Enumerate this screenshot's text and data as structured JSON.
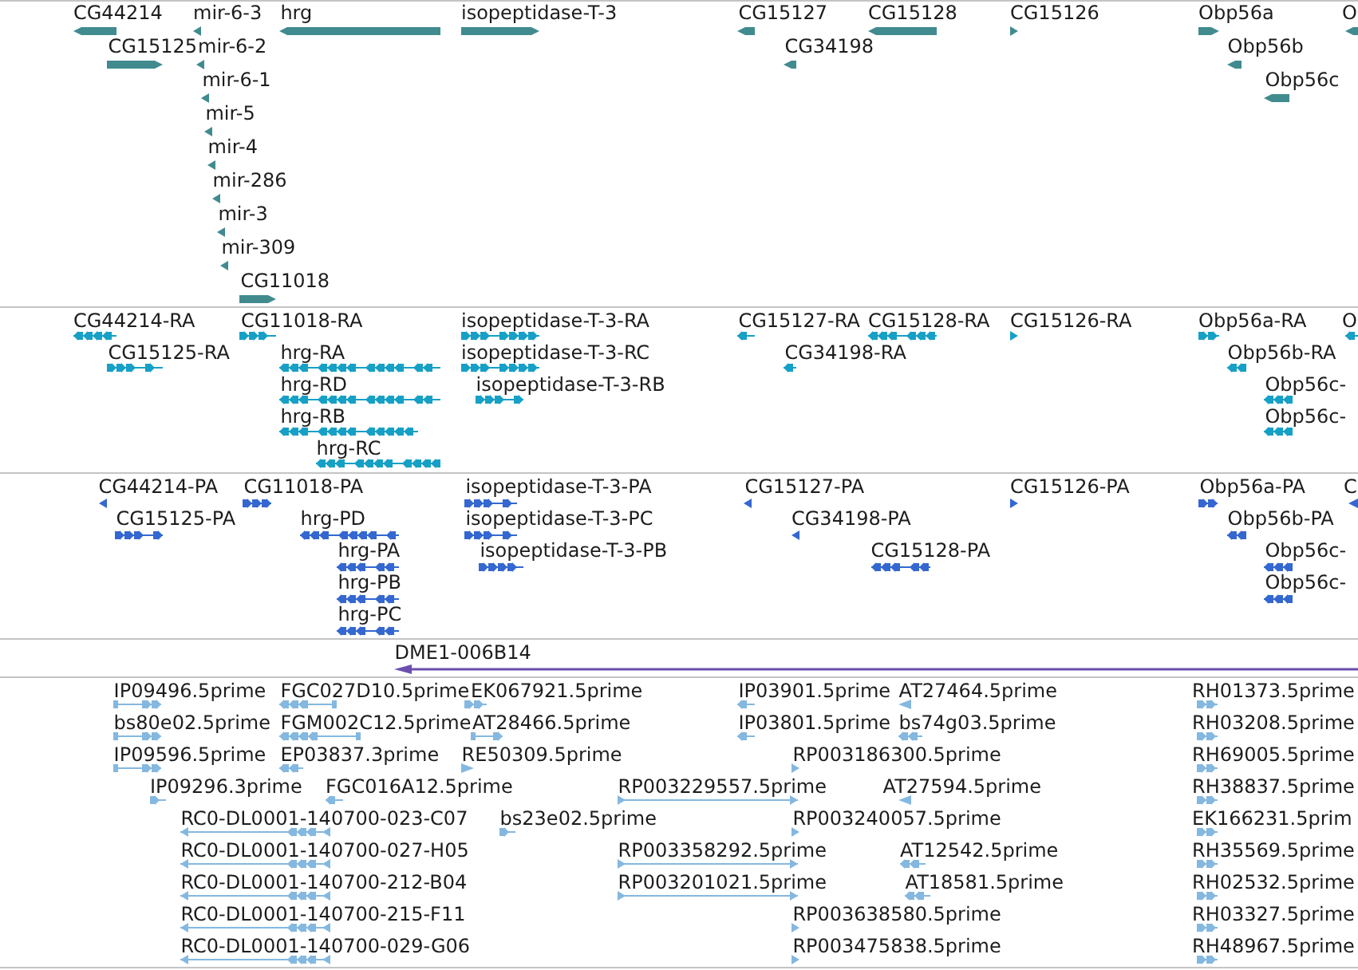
{
  "tracks": [
    {
      "kind": "gene",
      "color": "#418b8f",
      "features": [
        {
          "label": "CG44214",
          "reverse": true
        },
        {
          "label": "mir-6-3",
          "reverse": true
        },
        {
          "label": "hrg",
          "reverse": true
        },
        {
          "label": "isopeptidase-T-3",
          "reverse": false
        },
        {
          "label": "CG15127",
          "reverse": true
        },
        {
          "label": "CG15128",
          "reverse": true
        },
        {
          "label": "CG15126",
          "reverse": false
        },
        {
          "label": "Obp56a",
          "reverse": false
        },
        {
          "label": "O",
          "reverse": true
        },
        {
          "label": "CG15125",
          "reverse": false
        },
        {
          "label": "mir-6-2",
          "reverse": true
        },
        {
          "label": "CG34198",
          "reverse": true
        },
        {
          "label": "Obp56b",
          "reverse": true
        },
        {
          "label": "mir-6-1",
          "reverse": true
        },
        {
          "label": "Obp56c",
          "reverse": true
        },
        {
          "label": "mir-5",
          "reverse": true
        },
        {
          "label": "mir-4",
          "reverse": true
        },
        {
          "label": "mir-286",
          "reverse": true
        },
        {
          "label": "mir-3",
          "reverse": true
        },
        {
          "label": "mir-309",
          "reverse": true
        },
        {
          "label": "CG11018",
          "reverse": false
        }
      ]
    },
    {
      "kind": "transcript",
      "color": "#16a0c6",
      "features": [
        {
          "label": "CG44214-RA",
          "reverse": true
        },
        {
          "label": "CG11018-RA",
          "reverse": false
        },
        {
          "label": "isopeptidase-T-3-RA",
          "reverse": false
        },
        {
          "label": "CG15127-RA",
          "reverse": true
        },
        {
          "label": "CG15128-RA",
          "reverse": true
        },
        {
          "label": "CG15126-RA",
          "reverse": false
        },
        {
          "label": "Obp56a-RA",
          "reverse": false
        },
        {
          "label": "O",
          "reverse": true
        },
        {
          "label": "CG15125-RA",
          "reverse": false
        },
        {
          "label": "hrg-RA",
          "reverse": true
        },
        {
          "label": "isopeptidase-T-3-RC",
          "reverse": false
        },
        {
          "label": "CG34198-RA",
          "reverse": true
        },
        {
          "label": "Obp56b-RA",
          "reverse": true
        },
        {
          "label": "hrg-RD",
          "reverse": true
        },
        {
          "label": "isopeptidase-T-3-RB",
          "reverse": false
        },
        {
          "label": "Obp56c-",
          "reverse": true
        },
        {
          "label": "hrg-RB",
          "reverse": true
        },
        {
          "label": "Obp56c-",
          "reverse": true
        },
        {
          "label": "hrg-RC",
          "reverse": true
        }
      ]
    },
    {
      "kind": "protein",
      "color": "#3467d0",
      "features": [
        {
          "label": "CG44214-PA",
          "reverse": true
        },
        {
          "label": "CG11018-PA",
          "reverse": false
        },
        {
          "label": "isopeptidase-T-3-PA",
          "reverse": false
        },
        {
          "label": "CG15127-PA",
          "reverse": true
        },
        {
          "label": "CG15126-PA",
          "reverse": false
        },
        {
          "label": "Obp56a-PA",
          "reverse": false
        },
        {
          "label": "C",
          "reverse": true
        },
        {
          "label": "CG15125-PA",
          "reverse": false
        },
        {
          "label": "hrg-PD",
          "reverse": true
        },
        {
          "label": "isopeptidase-T-3-PC",
          "reverse": false
        },
        {
          "label": "CG34198-PA",
          "reverse": true
        },
        {
          "label": "Obp56b-PA",
          "reverse": true
        },
        {
          "label": "hrg-PA",
          "reverse": true
        },
        {
          "label": "isopeptidase-T-3-PB",
          "reverse": false
        },
        {
          "label": "CG15128-PA",
          "reverse": true
        },
        {
          "label": "Obp56c-",
          "reverse": true
        },
        {
          "label": "hrg-PB",
          "reverse": true
        },
        {
          "label": "Obp56c-",
          "reverse": true
        },
        {
          "label": "hrg-PC",
          "reverse": true
        }
      ]
    },
    {
      "kind": "clone",
      "color": "#6b4fae",
      "features": [
        {
          "label": "DME1-006B14",
          "reverse": true
        }
      ]
    },
    {
      "kind": "est",
      "color": "#84b8e0",
      "features": [
        {
          "label": "IP09496.5prime",
          "reverse": false
        },
        {
          "label": "FGC027D10.5prime",
          "reverse": true
        },
        {
          "label": "EK067921.5prime",
          "reverse": false
        },
        {
          "label": "IP03901.5prime",
          "reverse": true
        },
        {
          "label": "AT27464.5prime",
          "reverse": true
        },
        {
          "label": "RH01373.5prime",
          "reverse": false
        },
        {
          "label": "bs80e02.5prime",
          "reverse": false
        },
        {
          "label": "FGM002C12.5prime",
          "reverse": true
        },
        {
          "label": "AT28466.5prime",
          "reverse": false
        },
        {
          "label": "IP03801.5prime",
          "reverse": true
        },
        {
          "label": "bs74g03.5prime",
          "reverse": true
        },
        {
          "label": "RH03208.5prime",
          "reverse": false
        },
        {
          "label": "IP09596.5prime",
          "reverse": false
        },
        {
          "label": "EP03837.3prime",
          "reverse": true
        },
        {
          "label": "RE50309.5prime",
          "reverse": false
        },
        {
          "label": "RP003186300.5prime",
          "reverse": false
        },
        {
          "label": "RH69005.5prime",
          "reverse": false
        },
        {
          "label": "IP09296.3prime",
          "reverse": false
        },
        {
          "label": "FGC016A12.5prime",
          "reverse": true
        },
        {
          "label": "RP003229557.5prime",
          "reverse": false
        },
        {
          "label": "AT27594.5prime",
          "reverse": true
        },
        {
          "label": "RH38837.5prime",
          "reverse": false
        },
        {
          "label": "RC0-DL0001-140700-023-C07",
          "reverse": true
        },
        {
          "label": "bs23e02.5prime",
          "reverse": false
        },
        {
          "label": "RP003240057.5prime",
          "reverse": false
        },
        {
          "label": "EK166231.5prim",
          "reverse": false
        },
        {
          "label": "RC0-DL0001-140700-027-H05",
          "reverse": true
        },
        {
          "label": "RP003358292.5prime",
          "reverse": false
        },
        {
          "label": "AT12542.5prime",
          "reverse": true
        },
        {
          "label": "RH35569.5prime",
          "reverse": false
        },
        {
          "label": "RC0-DL0001-140700-212-B04",
          "reverse": true
        },
        {
          "label": "RP003201021.5prime",
          "reverse": false
        },
        {
          "label": "AT18581.5prime",
          "reverse": true
        },
        {
          "label": "RH02532.5prime",
          "reverse": false
        },
        {
          "label": "RC0-DL0001-140700-215-F11",
          "reverse": true
        },
        {
          "label": "RP003638580.5prime",
          "reverse": false
        },
        {
          "label": "RH03327.5prime",
          "reverse": false
        },
        {
          "label": "RC0-DL0001-140700-029-G06",
          "reverse": true
        },
        {
          "label": "RP003475838.5prime",
          "reverse": false
        },
        {
          "label": "RH48967.5prime",
          "reverse": false
        }
      ]
    }
  ]
}
